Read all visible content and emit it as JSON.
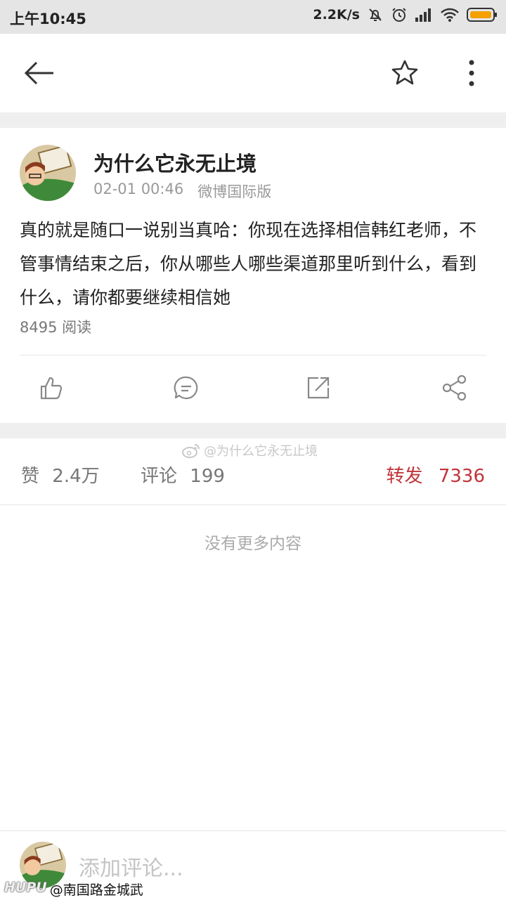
{
  "status_bar": {
    "time": "上午10:45",
    "net_speed": "2.2K/s"
  },
  "post": {
    "author": "为什么它永无止境",
    "date": "02-01 00:46",
    "source": "微博国际版",
    "text": "真的就是随口一说别当真哈：你现在选择相信韩红老师，不管事情结束之后，你从哪些人哪些渠道那里听到什么，看到什么，请你都要继续相信她",
    "reads": "8495 阅读"
  },
  "stats": {
    "likes_label": "赞",
    "likes_value": "2.4万",
    "comments_label": "评论",
    "comments_value": "199",
    "reposts_label": "转发",
    "reposts_value": "7336"
  },
  "watermark": "@为什么它永无止境",
  "no_more": "没有更多内容",
  "comment_placeholder": "添加评论...",
  "overlay": {
    "brand": "HUPU",
    "handle": "@南国路金城武"
  },
  "colors": {
    "accent": "#c0353a",
    "statusbar_bg": "#e5e5e5",
    "gap_bg": "#efefef"
  },
  "icons": [
    "back-arrow-icon",
    "star-icon",
    "more-vert-icon",
    "like-icon",
    "comment-icon",
    "repost-icon",
    "share-icon"
  ]
}
